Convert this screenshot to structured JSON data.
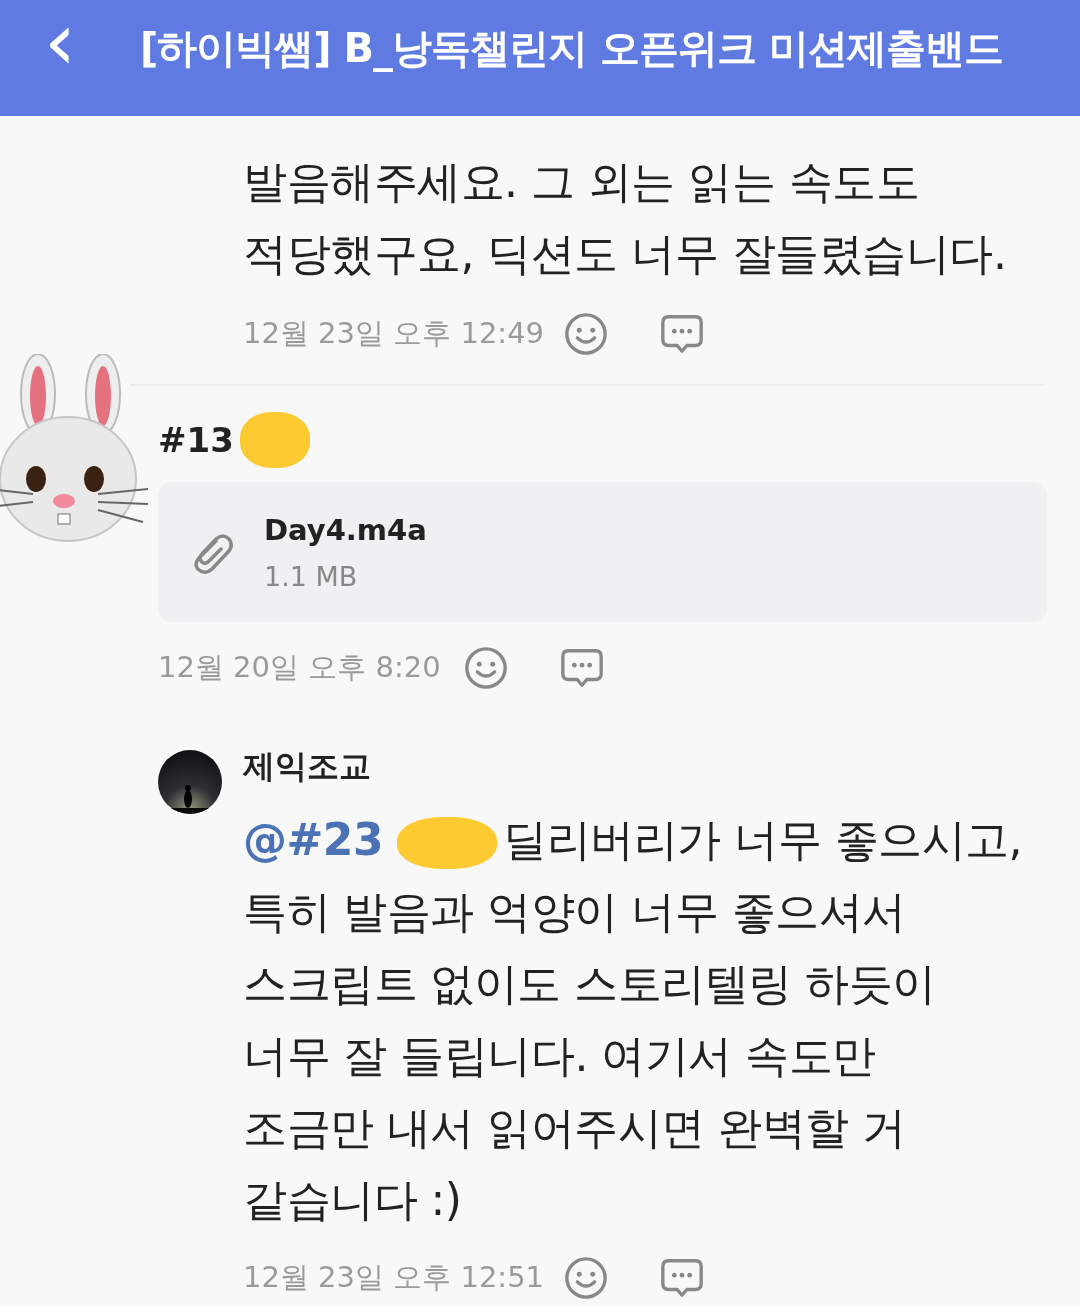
{
  "header": {
    "back_icon": "‹",
    "title": "[하이빅쌤] B_낭독챌린지 오픈위크 미션제출밴드"
  },
  "first_comment": {
    "text_lines": [
      "발음해주세요. 그 외는 읽는 속도도",
      "적당했구요, 딕션도 너무 잘들렸습니다."
    ],
    "time": "12월 23일 오후 12:49"
  },
  "post": {
    "author": "#13",
    "author_redacted": true,
    "attachment": {
      "name": "Day4.m4a",
      "size": "1.1 MB"
    },
    "time": "12월 20일 오후 8:20"
  },
  "reply": {
    "author": "제익조교",
    "mention": "@#23",
    "mention_redacted": true,
    "text_lines": [
      "딜리버리가 너무 좋으시고,",
      "특히 발음과 억양이 너무 좋으셔서",
      "스크립트 없이도 스토리텔링 하듯이",
      "너무 잘 들립니다. 여기서 속도만",
      "조금만 내서 읽어주시면 완벽할 거",
      "같습니다 :)"
    ],
    "time": "12월 23일 오후 12:51"
  }
}
